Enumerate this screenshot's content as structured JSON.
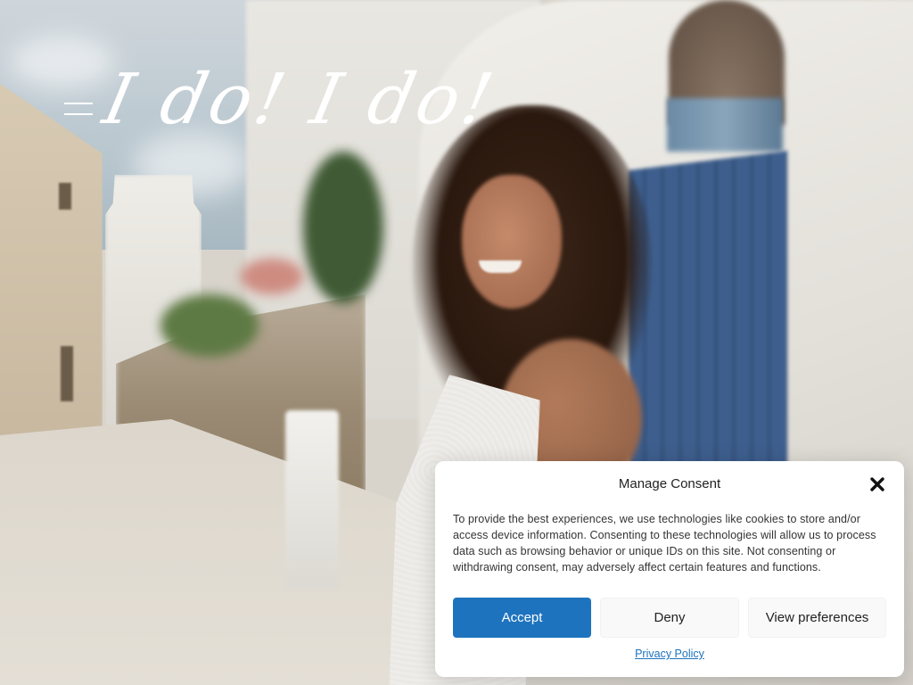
{
  "header": {
    "logo_text": "I do! I do!",
    "menu_icon": "hamburger-menu-icon"
  },
  "consent": {
    "title": "Manage Consent",
    "close_icon": "close-icon",
    "body": "To provide the best experiences, we use technologies like cookies to store and/or access device information. Consenting to these technologies will allow us to process data such as browsing behavior or unique IDs on this site. Not consenting or withdrawing consent, may adversely affect certain features and functions.",
    "accept_label": "Accept",
    "deny_label": "Deny",
    "preferences_label": "View preferences",
    "privacy_link": "Privacy Policy",
    "accent_color": "#1e73be"
  }
}
